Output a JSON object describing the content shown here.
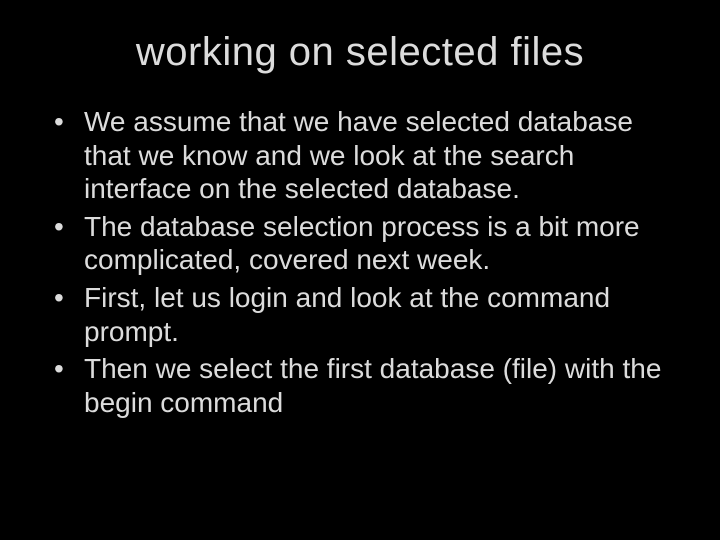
{
  "slide": {
    "title": "working on selected files",
    "bullets": [
      "We assume that we have selected database that we know and we look at the search interface on the selected database.",
      "The database selection process is a bit more complicated, covered next week.",
      "First, let us login and look at the command prompt.",
      "Then we select the first database (file) with the begin command"
    ]
  }
}
